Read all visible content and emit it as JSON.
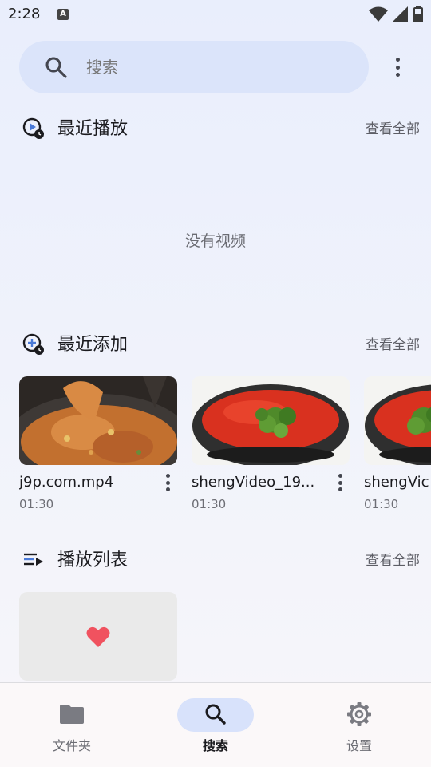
{
  "status_bar": {
    "time": "2:28",
    "a_badge": "A"
  },
  "search": {
    "placeholder": "搜索"
  },
  "recent_play": {
    "title": "最近播放",
    "view_all": "查看全部",
    "empty": "没有视频"
  },
  "recent_added": {
    "title": "最近添加",
    "view_all": "查看全部",
    "videos": [
      {
        "title": "j9p.com.mp4",
        "duration": "01:30"
      },
      {
        "title": "shengVideo_19...",
        "duration": "01:30"
      },
      {
        "title": "shengVic",
        "duration": "01:30"
      }
    ]
  },
  "playlists": {
    "title": "播放列表",
    "view_all": "查看全部"
  },
  "nav": {
    "items": [
      {
        "label": "文件夹",
        "icon": "folder-icon"
      },
      {
        "label": "搜索",
        "icon": "search-icon"
      },
      {
        "label": "设置",
        "icon": "gear-icon"
      }
    ],
    "active_index": 1
  },
  "colors": {
    "accent": "#d8e2fb",
    "heart": "#f0525f"
  }
}
